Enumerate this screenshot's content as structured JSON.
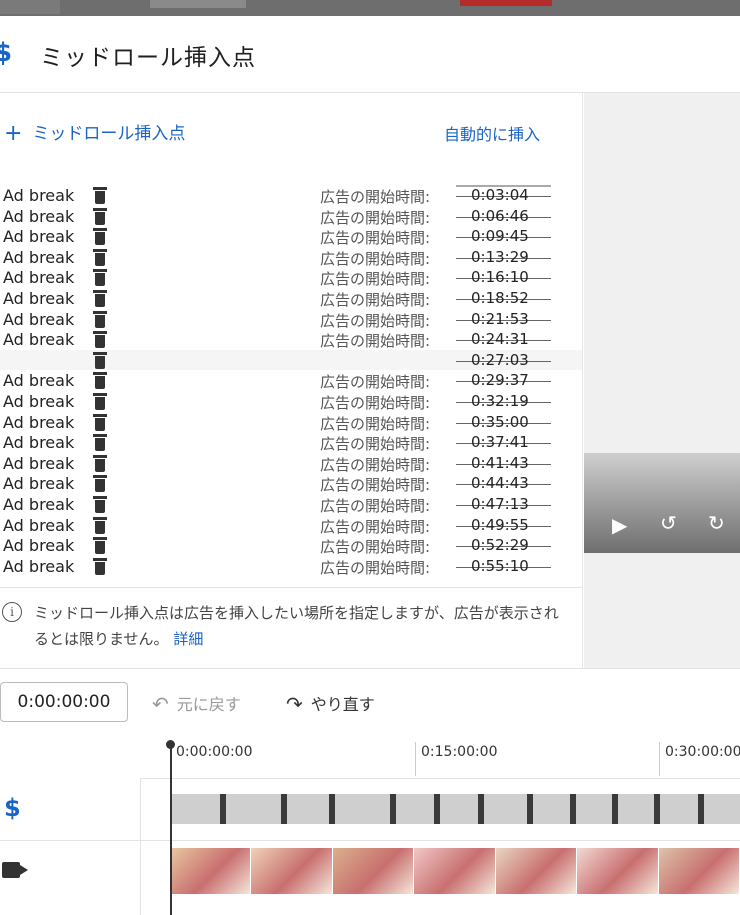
{
  "header": {
    "title": "ミッドロール挿入点"
  },
  "panel": {
    "add_label": "ミッドロール挿入点",
    "auto_label": "自動的に挿入",
    "breaks": [
      {
        "label": "Ad break",
        "start_label": "広告の開始時間:",
        "time": "0:03:04"
      },
      {
        "label": "Ad break",
        "start_label": "広告の開始時間:",
        "time": "0:06:46"
      },
      {
        "label": "Ad break",
        "start_label": "広告の開始時間:",
        "time": "0:09:45"
      },
      {
        "label": "Ad break",
        "start_label": "広告の開始時間:",
        "time": "0:13:29"
      },
      {
        "label": "Ad break",
        "start_label": "広告の開始時間:",
        "time": "0:16:10"
      },
      {
        "label": "Ad break",
        "start_label": "広告の開始時間:",
        "time": "0:18:52"
      },
      {
        "label": "Ad break",
        "start_label": "広告の開始時間:",
        "time": "0:21:53"
      },
      {
        "label": "Ad break",
        "start_label": "広告の開始時間:",
        "time": "0:24:31"
      },
      {
        "label": "",
        "start_label": "",
        "time": "0:27:03"
      },
      {
        "label": "Ad break",
        "start_label": "広告の開始時間:",
        "time": "0:29:37"
      },
      {
        "label": "Ad break",
        "start_label": "広告の開始時間:",
        "time": "0:32:19"
      },
      {
        "label": "Ad break",
        "start_label": "広告の開始時間:",
        "time": "0:35:00"
      },
      {
        "label": "Ad break",
        "start_label": "広告の開始時間:",
        "time": "0:37:41"
      },
      {
        "label": "Ad break",
        "start_label": "広告の開始時間:",
        "time": "0:41:43"
      },
      {
        "label": "Ad break",
        "start_label": "広告の開始時間:",
        "time": "0:44:43"
      },
      {
        "label": "Ad break",
        "start_label": "広告の開始時間:",
        "time": "0:47:13"
      },
      {
        "label": "Ad break",
        "start_label": "広告の開始時間:",
        "time": "0:49:55"
      },
      {
        "label": "Ad break",
        "start_label": "広告の開始時間:",
        "time": "0:52:29"
      },
      {
        "label": "Ad break",
        "start_label": "広告の開始時間:",
        "time": "0:55:10"
      }
    ],
    "info_text": "ミッドロール挿入点は広告を挿入したい場所を指定しますが、広告が表示されるとは限りません。",
    "info_link": "詳細"
  },
  "toolbar": {
    "timecode": "0:00:00:00",
    "undo_label": "元に戻す",
    "redo_label": "やり直す"
  },
  "timeline": {
    "ruler_labels": [
      "0:00:00:00",
      "0:15:00:00",
      "0:30:00:00"
    ]
  },
  "colors": {
    "accent": "#1a64c8",
    "marker": "#3a3a3a",
    "track": "#cfcfcf"
  },
  "icons": [
    "dollar-icon",
    "plus-icon",
    "trash-icon",
    "info-icon",
    "undo-icon",
    "redo-icon",
    "play-icon",
    "replay-10-icon",
    "forward-10-icon",
    "camera-icon"
  ]
}
